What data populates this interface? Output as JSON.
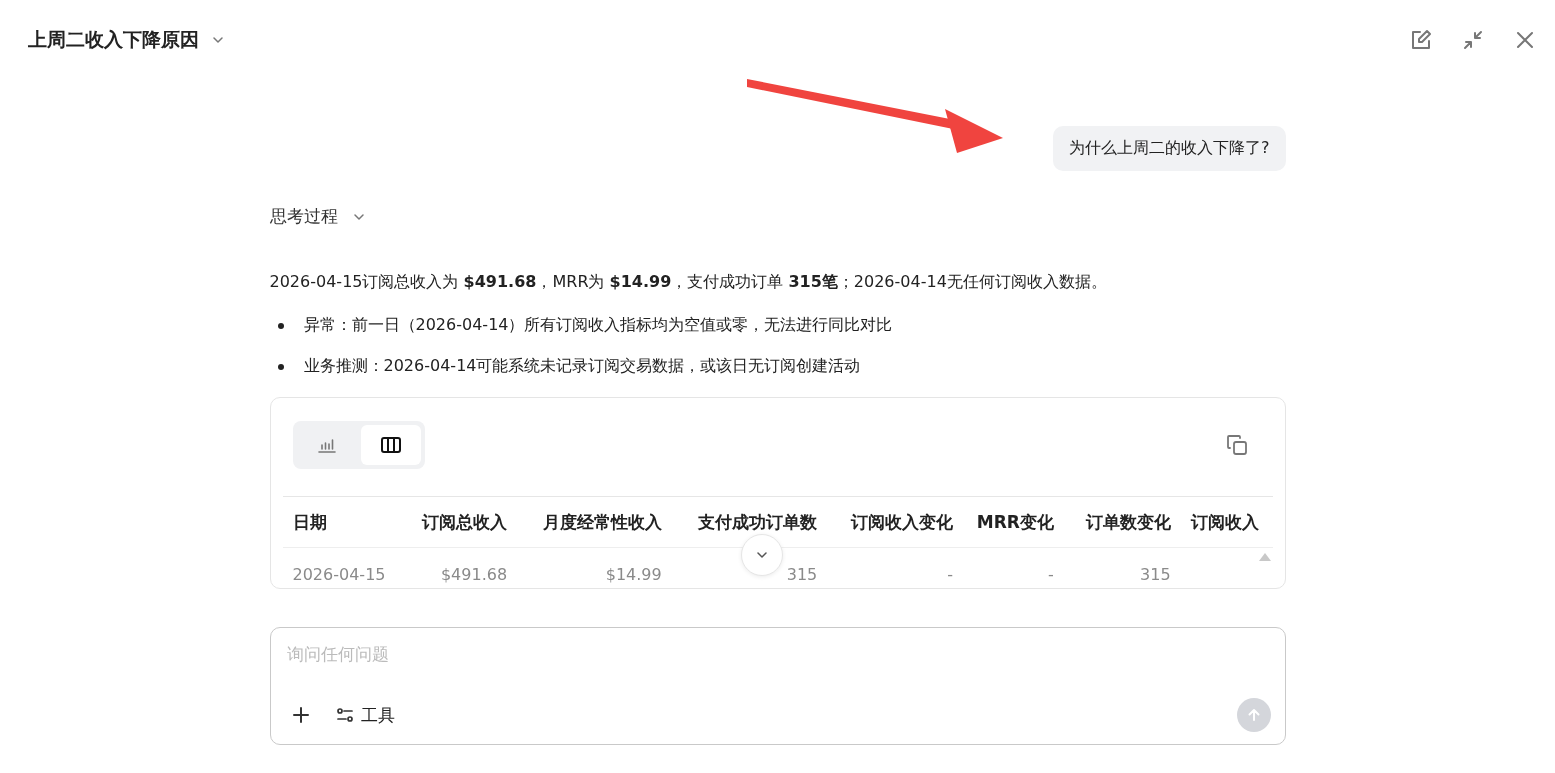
{
  "header": {
    "title": "上周二收入下降原因",
    "actions": [
      {
        "kind": "edit"
      },
      {
        "kind": "collapse"
      },
      {
        "kind": "close"
      }
    ]
  },
  "question": "为什么上周二的收入下降了?",
  "thinking": {
    "label": "思考过程",
    "expanded": false
  },
  "summary": "2026-04-15订阅总收入为 **$491.68**，MRR为 **$14.99**，支付成功订单 **315笔**；2026-04-14无任何订阅收入数据。",
  "bullets": [
    "异常：前一日（2026-04-14）所有订阅收入指标均为空值或零，无法进行同比对比",
    "业务推测：2026-04-14可能系统未记录订阅交易数据，或该日无订阅创建活动"
  ],
  "result_card": {
    "views": [
      {
        "kind": "chart",
        "selected": false
      },
      {
        "kind": "table",
        "selected": true
      }
    ],
    "table": {
      "columns": [
        "日期",
        "订阅总收入",
        "月度经常性收入",
        "支付成功订单数",
        "订阅收入变化",
        "MRR变化",
        "订单数变化",
        "订阅收入"
      ],
      "rows": [
        [
          "2026-04-15",
          "$491.68",
          "$14.99",
          "315",
          "-",
          "-",
          "315"
        ]
      ]
    }
  },
  "composer": {
    "placeholder": "询问任何问题",
    "tools_label": "工具"
  }
}
